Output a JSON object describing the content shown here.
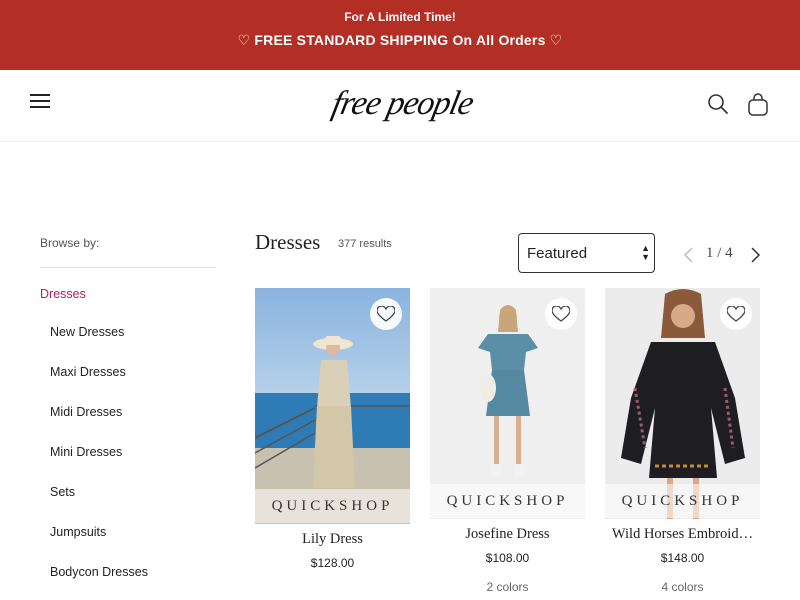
{
  "promo": {
    "line1": "For A Limited Time!",
    "line2": "♡ FREE STANDARD SHIPPING On All Orders ♡"
  },
  "header": {
    "logo": "free people",
    "icons": [
      "menu-icon",
      "search-icon",
      "bag-icon"
    ]
  },
  "sidebar": {
    "browse_label": "Browse by:",
    "active": "Dresses",
    "items": [
      "New Dresses",
      "Maxi Dresses",
      "Midi Dresses",
      "Mini Dresses",
      "Sets",
      "Jumpsuits",
      "Bodycon Dresses"
    ]
  },
  "main": {
    "title": "Dresses",
    "results": "377 results",
    "sort": {
      "selected": "Featured"
    },
    "pagination": {
      "current": 1,
      "total": 4,
      "text": "1 / 4"
    }
  },
  "products": [
    {
      "name": "Lily Dress",
      "price": "$128.00",
      "colors": "",
      "quickshop": "QUICKSHOP"
    },
    {
      "name": "Josefine Dress",
      "price": "$108.00",
      "colors": "2 colors",
      "quickshop": "QUICKSHOP"
    },
    {
      "name": "Wild Horses Embroid…",
      "price": "$148.00",
      "colors": "4 colors",
      "quickshop": "QUICKSHOP"
    }
  ],
  "colors": {
    "banner": "#b32f26",
    "active_link": "#b0215a"
  }
}
